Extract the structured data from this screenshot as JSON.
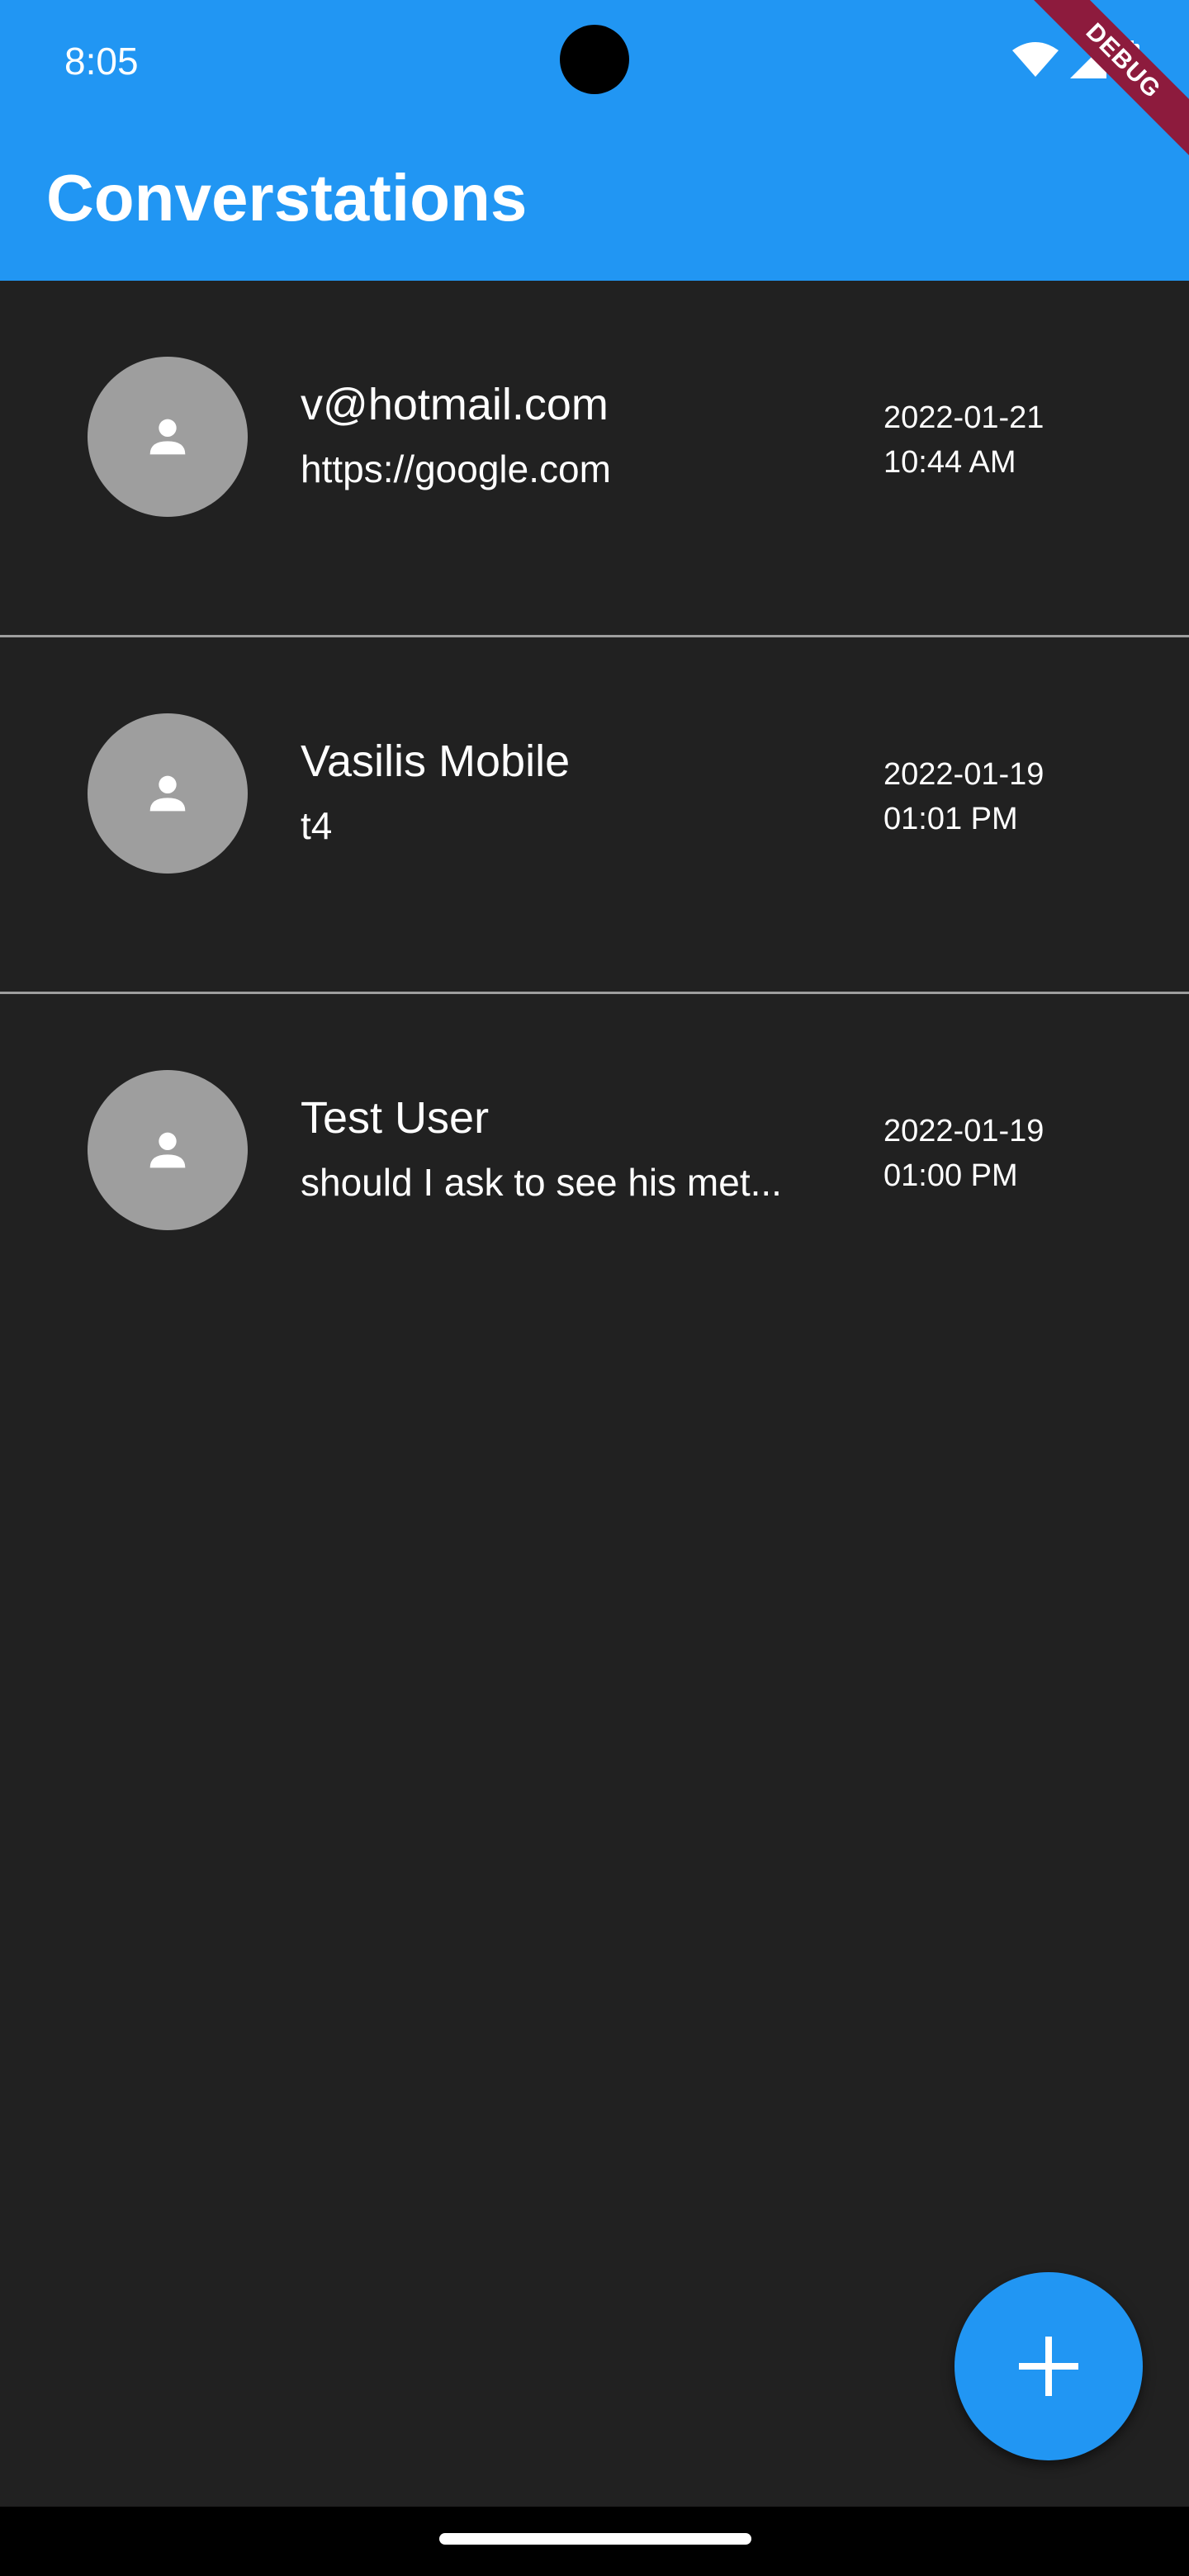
{
  "status_bar": {
    "time": "8:05",
    "icons": [
      "wifi-icon",
      "signal-icon",
      "battery-icon"
    ]
  },
  "debug_banner": {
    "label": "DEBUG"
  },
  "app_bar": {
    "title": "Converstations",
    "color": "#2196f3"
  },
  "conversations": [
    {
      "name": "v@hotmail.com",
      "preview": "https://google.com",
      "date": "2022-01-21",
      "time": "10:44 AM",
      "avatar_icon": "person-icon"
    },
    {
      "name": "Vasilis Mobile",
      "preview": "t4",
      "date": "2022-01-19",
      "time": "01:01 PM",
      "avatar_icon": "person-icon"
    },
    {
      "name": "Test User",
      "preview": "should I ask to see his met...",
      "date": "2022-01-19",
      "time": "01:00 PM",
      "avatar_icon": "person-icon"
    }
  ],
  "fab": {
    "icon": "plus-icon",
    "color": "#2196f3"
  },
  "colors": {
    "background": "#212121",
    "avatar": "#9e9e9e",
    "divider": "#9e9e9e",
    "debug_banner": "#8d1b3d"
  }
}
